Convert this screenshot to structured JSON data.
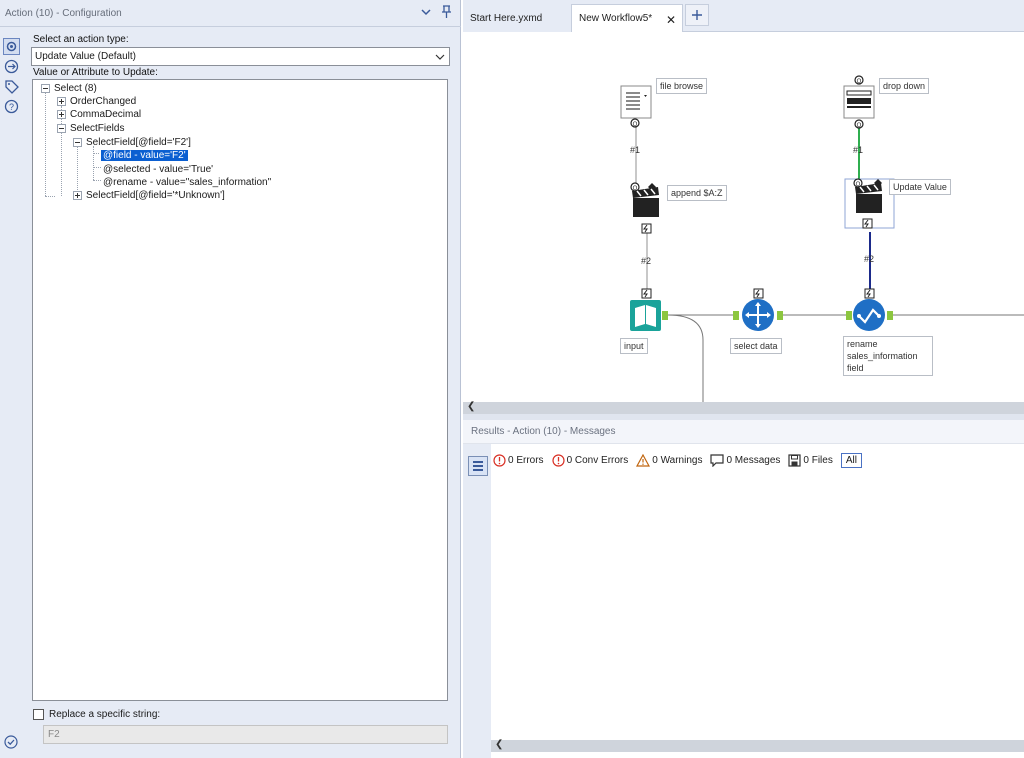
{
  "config": {
    "title": "Action (10) - Configuration",
    "action_type_label": "Select an action type:",
    "action_type_value": "Update Value (Default)",
    "value_label": "Value or Attribute to Update:",
    "tree": {
      "root": "Select (8)",
      "order_changed": "OrderChanged",
      "comma_decimal": "CommaDecimal",
      "select_fields": "SelectFields",
      "select_field_f2": "SelectField[@field='F2']",
      "attr_field": "@field - value='F2'",
      "attr_selected": "@selected - value='True'",
      "attr_rename": "@rename - value=\"sales_information\"",
      "select_field_unknown": "SelectField[@field='*Unknown']"
    },
    "replace_label": "Replace a specific string:",
    "replace_value": "F2"
  },
  "tabs": [
    {
      "label": "Start Here.yxmd"
    },
    {
      "label": "New Workflow5*"
    }
  ],
  "workflow": {
    "tools": {
      "file_browse": "file browse",
      "drop_down": "drop down",
      "append": "append $A:Z",
      "update_value": "Update Value",
      "input": "input",
      "select_data": "select data",
      "rename_line1": "rename",
      "rename_line2": "sales_information",
      "rename_line3": "field"
    },
    "connections": {
      "c1a": "#1",
      "c1b": "#1",
      "c2a": "#2",
      "c2b": "#2"
    }
  },
  "results": {
    "title": "Results - Action (10) - Messages",
    "errors": "0 Errors",
    "conv_errors": "0 Conv Errors",
    "warnings": "0 Warnings",
    "messages": "0 Messages",
    "files": "0 Files",
    "all": "All"
  },
  "colors": {
    "selection": "#0b5fd1",
    "input_tool": "#1aa39a",
    "select_tool": "#1f6fc5",
    "connector_green": "#2fae4f",
    "connector_navy": "#1b2a8a",
    "anchor_green": "#8cc63f",
    "error_red": "#d93025"
  }
}
